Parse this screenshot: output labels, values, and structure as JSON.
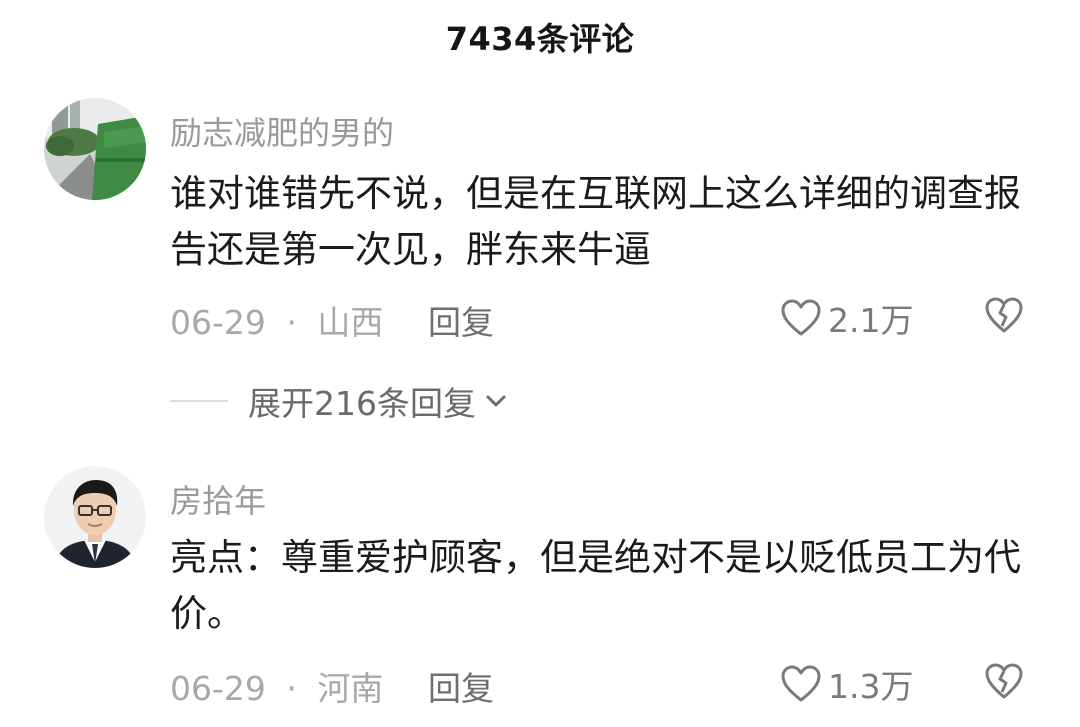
{
  "header": {
    "title": "7434条评论"
  },
  "comments": [
    {
      "username": "励志减肥的男的",
      "text": "谁对谁错先不说，但是在互联网上这么详细的调查报告还是第一次见，胖东来牛逼",
      "date": "06-29",
      "separator": "·",
      "location": "山西",
      "reply_label": "回复",
      "like_count": "2.1万",
      "avatar_icon": "street-photo-avatar"
    },
    {
      "username": "房拾年",
      "text": "亮点：尊重爱护顾客，但是绝对不是以贬低员工为代价。",
      "date": "06-29",
      "separator": "·",
      "location": "河南",
      "reply_label": "回复",
      "like_count": "1.3万",
      "avatar_icon": "man-in-suit-avatar"
    }
  ],
  "expand_replies": {
    "label": "展开216条回复"
  },
  "icons": {
    "like": "heart-outline-icon",
    "dislike": "broken-heart-icon",
    "expand": "chevron-down-icon"
  },
  "colors": {
    "text_primary": "#1b1b1b",
    "text_secondary": "#9a9a9a",
    "icon_gray": "#7a7a7a"
  }
}
